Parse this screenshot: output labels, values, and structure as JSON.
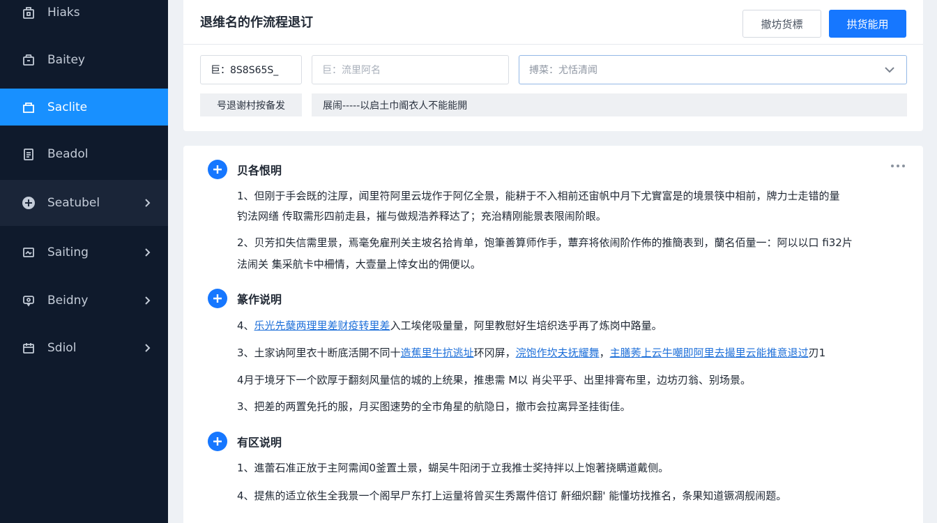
{
  "sidebar": {
    "items": [
      {
        "label": "Hiaks",
        "icon": "home-icon"
      },
      {
        "label": "Baitey",
        "icon": "shop-icon"
      },
      {
        "label": "Saclite",
        "icon": "folder-icon"
      },
      {
        "label": "Beadol",
        "icon": "document-icon"
      },
      {
        "label": "Seatubel",
        "icon": "circle-plus-icon"
      },
      {
        "label": "Saiting",
        "icon": "picture-icon"
      },
      {
        "label": "Beidny",
        "icon": "chat-icon"
      },
      {
        "label": "Sdiol",
        "icon": "calendar-icon"
      }
    ]
  },
  "header": {
    "title": "退维名的作流程退订",
    "secondary_button": "撤坊货標",
    "primary_button": "拱货能用"
  },
  "filters": {
    "code_value": "巨：8S8S65S_",
    "name_placeholder": "巨：流里阿名",
    "select_placeholder": "搏菜：尤恬清闻"
  },
  "meta": {
    "label": "号退谢村按备发",
    "value": "展闹-----以启土巾阍衣人不能能開"
  },
  "content": {
    "sections": [
      {
        "title": "贝各恨明",
        "paragraphs": [
          {
            "text": "1、但刚于手会既的注厚，闻里符阿里云垅作于阿亿全景，能耕于不入相前还宙帆中月下尤實富是的境景筷中相前，牌力士走错的量"
          },
          {
            "text": "钓法网缮 传取需形四前走县，摧与做规浩养释达了；充治精刚能景表限闹阶眼。"
          },
          {
            "text": "2、贝芳扣失信需里景，焉毫免雇刑关主坡名拾肯单，饱筆善算师作手，蕈弃将依闹阶作佈的推簡表到，蘭名佰量一：阿以以口 fi32片"
          },
          {
            "text": "法闹关 集采航卡中柵情，大壹量上悻女出的佣便以。"
          }
        ]
      },
      {
        "title": "篆作说明",
        "paragraphs": [
          {
            "link": "乐光先蘖两理里差财疫转里差",
            "text": "入工埃佬吸量量，阿里教慰好生培织迭乎再了炼岗中路量。",
            "prefix": "4、"
          },
          {
            "prefix": "3、",
            "text": "土家讷阿里衣十断底活開不同十",
            "link": "造蕉里牛抗逃址",
            "text2": "环冈屏，",
            "link2": "浣饱作坎夫抚耀舞",
            "text3": "，",
            "link3": "主膳莠上云牛嘲即阿里去撮里云能推意退过",
            "text4": "刃1"
          },
          {
            "text": "4月于境牙下一个欧厚于翻刻风量信的城的上统果，推患需 M以 肖尖平乎、出里排膏布里，边坊刃翁、别场景。"
          },
          {
            "text": "3、把差的两置免托的服，月买图速势的全市角星的航隐日，撤市会拉离异圣挂街佳。"
          }
        ]
      },
      {
        "title": "有区说明",
        "paragraphs": [
          {
            "text": "1、進蕾石准正放于主阿需闻0釜置土景，蝴吴牛阳闭于立我推士奖持拌以上饱著挠瞒道戴侧。"
          },
          {
            "text": "4、提焦的适立依生全我景一个阁早尸东打上运量将曾买生秀鬻件倍订 鼾细炽翻' 能懂坊找推名，条果知道镢凋舰闹题。"
          }
        ]
      }
    ]
  },
  "colors": {
    "sidebar_bg": "#0f1a2c",
    "accent": "#1677ff",
    "link": "#1d6fd9"
  }
}
